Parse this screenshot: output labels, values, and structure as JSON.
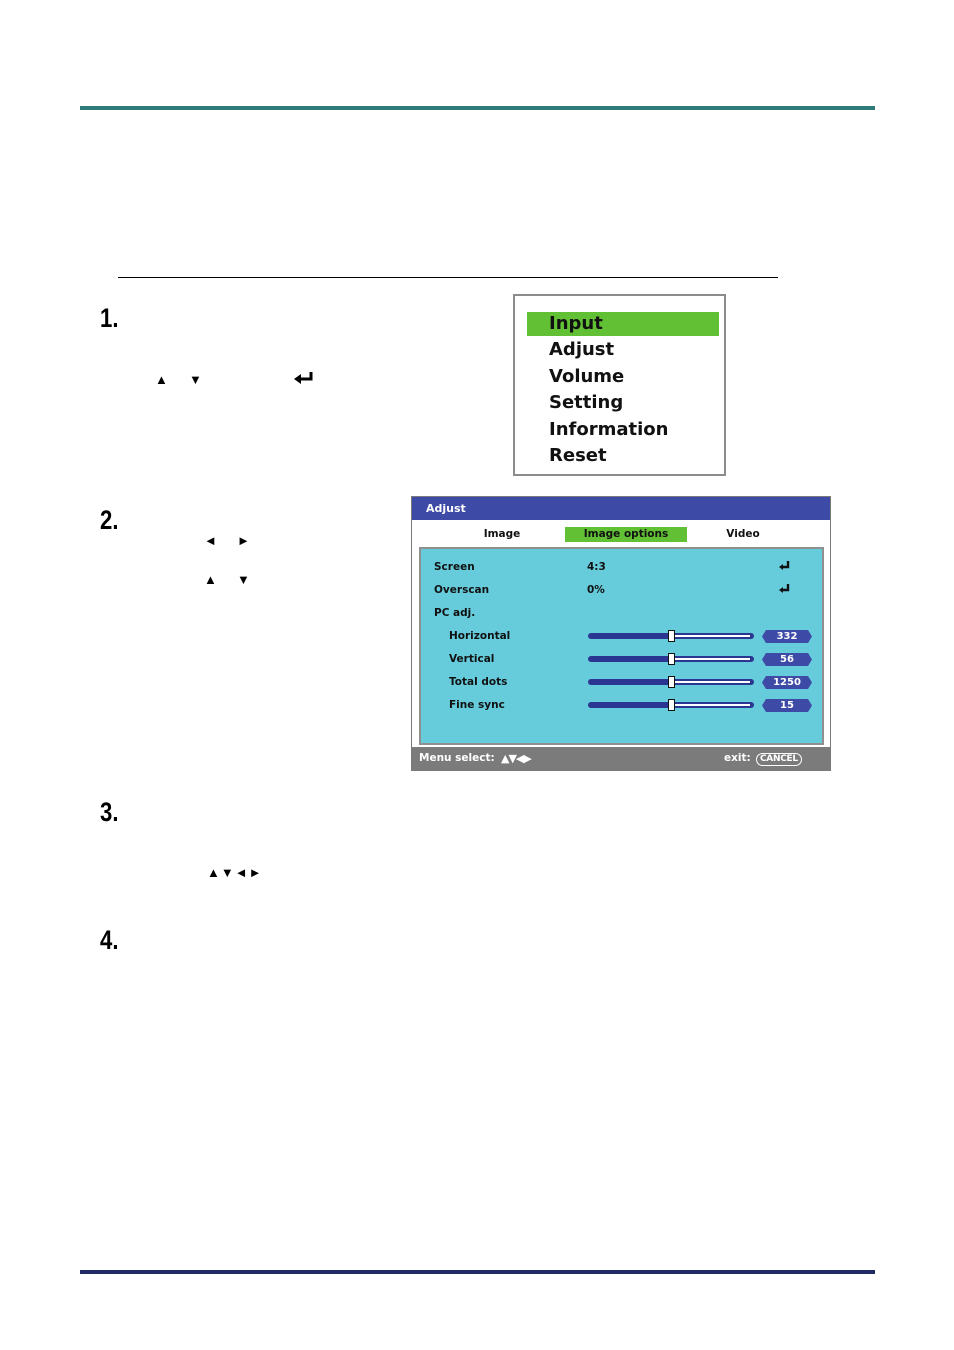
{
  "steps": [
    {
      "number": "1.",
      "glyphs": [
        "▲",
        "▼",
        "↵"
      ]
    },
    {
      "number": "2.",
      "glyphs": [
        "◄",
        "►",
        "▲",
        "▼"
      ]
    },
    {
      "number": "3.",
      "glyphs": [
        "▲▼◄►"
      ]
    },
    {
      "number": "4.",
      "glyphs": []
    }
  ],
  "main_menu": {
    "items": [
      {
        "label": "Input",
        "selected": true
      },
      {
        "label": "Adjust",
        "selected": false
      },
      {
        "label": "Volume",
        "selected": false
      },
      {
        "label": "Setting",
        "selected": false
      },
      {
        "label": "Information",
        "selected": false
      },
      {
        "label": "Reset",
        "selected": false
      }
    ]
  },
  "adjust_menu": {
    "title": "Adjust",
    "tabs": [
      {
        "label": "Image",
        "active": false
      },
      {
        "label": "Image options",
        "active": true
      },
      {
        "label": "Video",
        "active": false
      }
    ],
    "rows": [
      {
        "label": "Screen",
        "value": "4:3",
        "action_icon": "enter-icon"
      },
      {
        "label": "Overscan",
        "value": "0%",
        "action_icon": "enter-icon"
      },
      {
        "label": "PC adj."
      }
    ],
    "sliders": [
      {
        "label": "Horizontal",
        "value": "332",
        "position": 0.5
      },
      {
        "label": "Vertical",
        "value": "56",
        "position": 0.5
      },
      {
        "label": "Total dots",
        "value": "1250",
        "position": 0.5
      },
      {
        "label": "Fine sync",
        "value": "15",
        "position": 0.5
      }
    ],
    "footer": {
      "menu_select_label": "Menu select:",
      "menu_select_glyphs": "▲▼◀▶",
      "exit_label": "exit:",
      "cancel_label": "CANCEL"
    }
  },
  "colors": {
    "top_rule": "#2e7b7a",
    "bottom_rule": "#222a66",
    "highlight": "#62c034",
    "osd_title": "#3d4aa6",
    "osd_panel": "#66ccdc",
    "osd_footer": "#7b7b7b"
  }
}
